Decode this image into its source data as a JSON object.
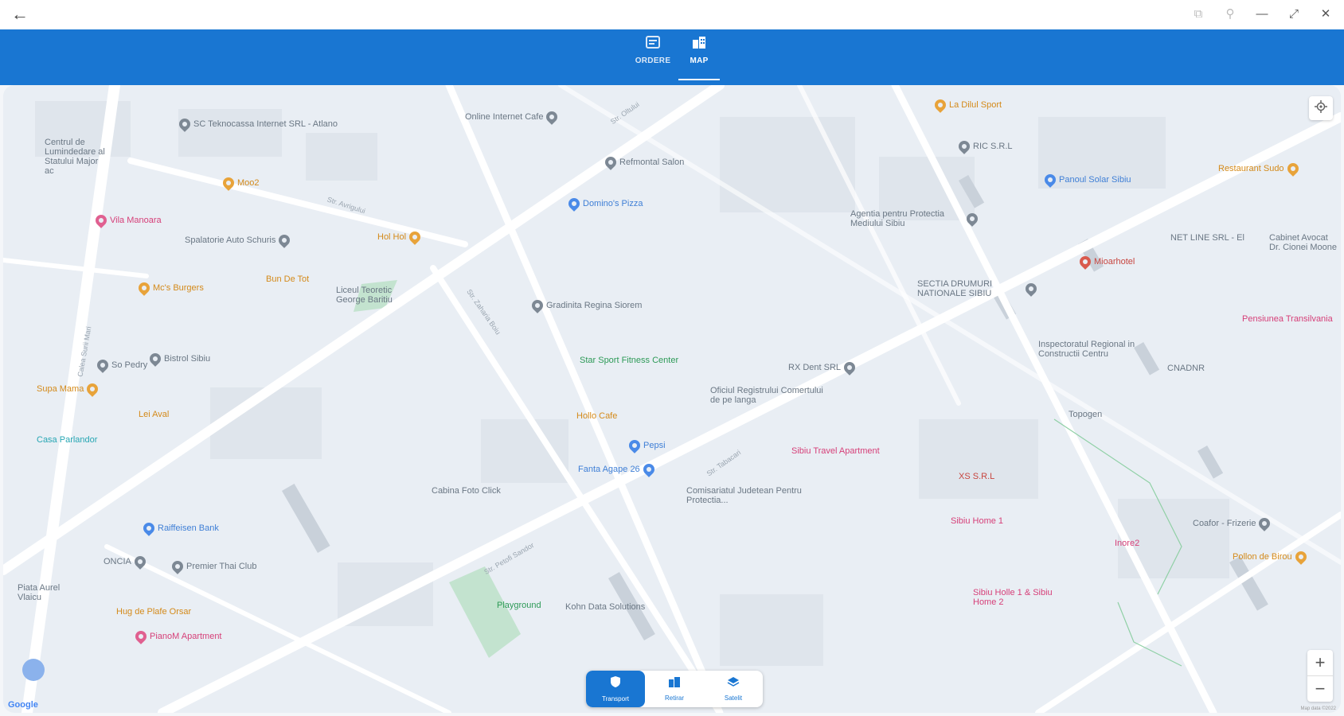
{
  "window": {
    "back_icon": "arrow-left-icon",
    "controls": [
      "copy-icon",
      "pin-icon",
      "minimize-icon",
      "restore-icon",
      "close-icon"
    ]
  },
  "nav": {
    "tabs": [
      {
        "label": "ORDERE",
        "icon": "orders-icon",
        "active": false
      },
      {
        "label": "MAP",
        "icon": "buildings-icon",
        "active": true
      }
    ],
    "accent": "#1976d2"
  },
  "map": {
    "pois": [
      {
        "label": "SC Teknocassa Internet SRL - Atlano",
        "color": "grey"
      },
      {
        "label": "Online Internet Cafe",
        "color": "grey"
      },
      {
        "label": "La Dilul Sport",
        "color": "orange"
      },
      {
        "label": "RIC S.R.L",
        "color": "grey"
      },
      {
        "label": "Centrul de Lumindedare al Statului Major ac",
        "color": "grey"
      },
      {
        "label": "Refmontal Salon",
        "color": "grey"
      },
      {
        "label": "Moo2",
        "color": "orange"
      },
      {
        "label": "Domino's Pizza",
        "color": "blue"
      },
      {
        "label": "Panoul Solar Sibiu",
        "color": "blue"
      },
      {
        "label": "Restaurant Sudo",
        "color": "orange"
      },
      {
        "label": "Vila Manoara",
        "color": "pink"
      },
      {
        "label": "Agentia pentru Protectia Mediului Sibiu",
        "color": "grey"
      },
      {
        "label": "Spalatorie Auto Schuris",
        "color": "grey"
      },
      {
        "label": "Hol Hol",
        "color": "orange"
      },
      {
        "label": "NET LINE SRL - El",
        "color": "grey"
      },
      {
        "label": "Cabinet Avocat Dr. Cionei Moone",
        "color": "grey"
      },
      {
        "label": "Mioarhotel",
        "color": "red"
      },
      {
        "label": "Mc's Burgers",
        "color": "orange"
      },
      {
        "label": "Bun De Tot",
        "color": "orange"
      },
      {
        "label": "Liceul Teoretic George Baritiu",
        "color": "grey"
      },
      {
        "label": "Gradinita Regina Siorem",
        "color": "grey"
      },
      {
        "label": "SECTIA DRUMURI NATIONALE SIBIU",
        "color": "grey"
      },
      {
        "label": "Pensiunea Transilvania",
        "color": "pink"
      },
      {
        "label": "So Pedry",
        "color": "grey"
      },
      {
        "label": "Bistrol Sibiu",
        "color": "grey"
      },
      {
        "label": "Star Sport Fitness Center",
        "color": "green"
      },
      {
        "label": "RX Dent SRL",
        "color": "grey"
      },
      {
        "label": "Inspectoratul Regional in Constructii Centru",
        "color": "grey"
      },
      {
        "label": "CNADNR",
        "color": "grey"
      },
      {
        "label": "Supa Mama",
        "color": "orange"
      },
      {
        "label": "Hollo Cafe",
        "color": "orange"
      },
      {
        "label": "Oficiul Registrului Comertului de pe langa",
        "color": "grey"
      },
      {
        "label": "Topogen",
        "color": "grey"
      },
      {
        "label": "Lei Aval",
        "color": "orange"
      },
      {
        "label": "Casa Parlandor",
        "color": "teal"
      },
      {
        "label": "Pepsi",
        "color": "blue"
      },
      {
        "label": "Sibiu Travel Apartment",
        "color": "pink"
      },
      {
        "label": "Fanta Agape 26",
        "color": "blue"
      },
      {
        "label": "Comisariatul Judetean Pentru Protectia...",
        "color": "grey"
      },
      {
        "label": "XS S.R.L",
        "color": "red"
      },
      {
        "label": "Cabina Foto Click",
        "color": "grey"
      },
      {
        "label": "Sibiu Home 1",
        "color": "pink"
      },
      {
        "label": "Inore2",
        "color": "pink"
      },
      {
        "label": "Coafor - Frizerie",
        "color": "grey"
      },
      {
        "label": "Raiffeisen Bank",
        "color": "blue"
      },
      {
        "label": "Pollon de Birou",
        "color": "orange"
      },
      {
        "label": "ONCIA",
        "color": "grey"
      },
      {
        "label": "Premier Thai Club",
        "color": "grey"
      },
      {
        "label": "Piata Aurel Vlaicu",
        "color": "grey"
      },
      {
        "label": "Hug de Plafe Orsar",
        "color": "orange"
      },
      {
        "label": "Playground",
        "color": "green"
      },
      {
        "label": "Kohn Data Solutions",
        "color": "grey"
      },
      {
        "label": "Sibiu Holle 1 & Sibiu Home 2",
        "color": "pink"
      },
      {
        "label": "PianoM Apartment",
        "color": "pink"
      }
    ],
    "streets": [
      "Str. Avrigului",
      "Str. Oltului",
      "Calea Surii Mari",
      "Str. Zaharia Boiu",
      "Str. Tabacari",
      "Str. Petofi Sandor"
    ],
    "attribution": "Google",
    "map_data": "Map data ©2022"
  },
  "map_controls": {
    "locate_icon": "crosshair-icon",
    "zoom_in": "+",
    "zoom_out": "−"
  },
  "bottom_segments": [
    {
      "label": "Transport",
      "icon": "shield-icon",
      "active": true
    },
    {
      "label": "Retirar",
      "icon": "buildings-icon",
      "active": false
    },
    {
      "label": "Satelit",
      "icon": "layers-icon",
      "active": false
    }
  ]
}
